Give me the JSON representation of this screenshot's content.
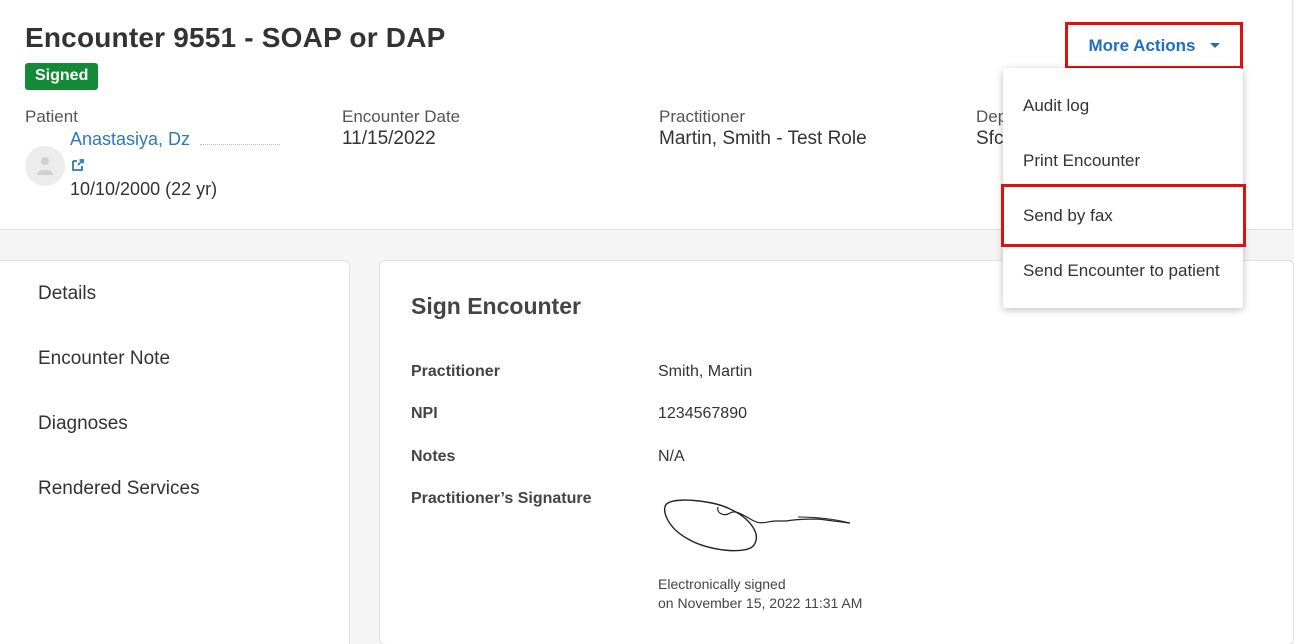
{
  "header": {
    "title": "Encounter 9551 - SOAP or DAP",
    "status_badge": "Signed",
    "fields": {
      "patient_label": "Patient",
      "patient_name": "Anastasiya, Dz",
      "patient_dob": "10/10/2000 (22 yr)",
      "encounter_date_label": "Encounter Date",
      "encounter_date": "11/15/2022",
      "practitioner_label": "Practitioner",
      "practitioner": "Martin, Smith - Test Role",
      "department_label_partial": "Dep",
      "department_value_partial": "Sfc"
    },
    "more_actions_label": "More Actions"
  },
  "dropdown": {
    "items": [
      {
        "label": "Audit log"
      },
      {
        "label": "Print Encounter"
      },
      {
        "label": "Send by fax"
      },
      {
        "label": "Send Encounter to patient"
      }
    ]
  },
  "sidebar": {
    "items": [
      {
        "label": "Details"
      },
      {
        "label": "Encounter Note"
      },
      {
        "label": "Diagnoses"
      },
      {
        "label": "Rendered Services"
      }
    ]
  },
  "sign_encounter": {
    "title": "Sign Encounter",
    "rows": [
      {
        "label": "Practitioner",
        "value": "Smith, Martin"
      },
      {
        "label": "NPI",
        "value": "1234567890"
      },
      {
        "label": "Notes",
        "value": "N/A"
      },
      {
        "label": "Practitioner’s Signature",
        "value": ""
      }
    ],
    "esign_line1": "Electronically signed",
    "esign_line2": "on November 15, 2022 11:31 AM"
  },
  "colors": {
    "accent": "#1f6fbf",
    "link": "#2a7ac0",
    "status_signed": "#138a36",
    "highlight_box": "#e01010"
  }
}
